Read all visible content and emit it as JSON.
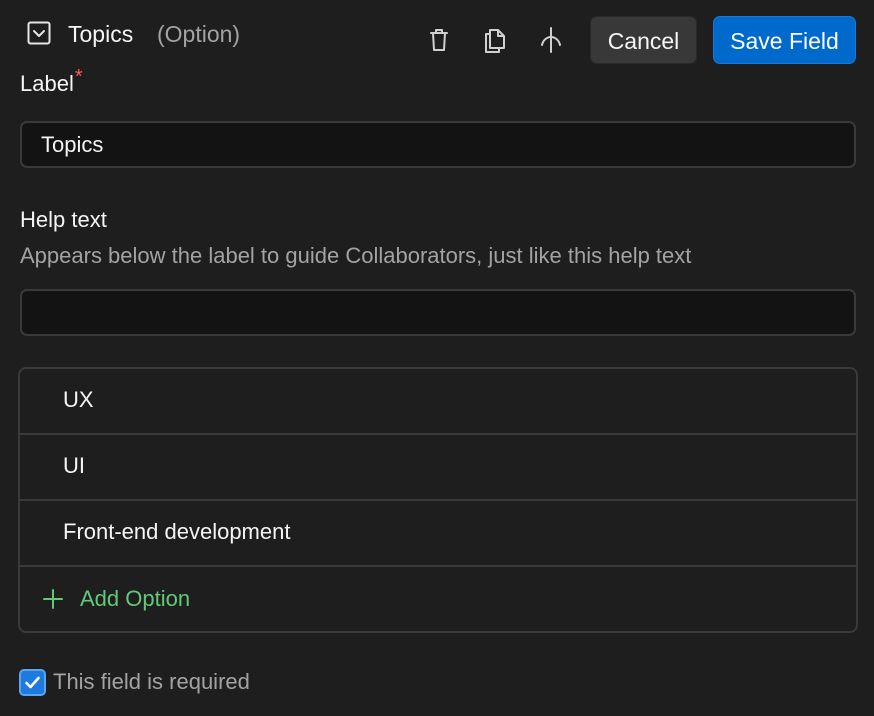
{
  "header": {
    "field_type_icon": "dropdown-square-icon",
    "title": "Topics",
    "field_type": "(Option)",
    "tools": [
      {
        "name": "delete",
        "icon": "trash-icon"
      },
      {
        "name": "duplicate",
        "icon": "copy-icon"
      },
      {
        "name": "branch",
        "icon": "branch-icon"
      }
    ],
    "cancel_label": "Cancel",
    "save_label": "Save Field"
  },
  "label_section": {
    "title": "Label",
    "required_marker": "*",
    "value": "Topics"
  },
  "help_section": {
    "title": "Help text",
    "description": "Appears below the label to guide Collaborators, just like this help text",
    "value": "",
    "placeholder": ""
  },
  "options": {
    "items": [
      {
        "label": "UX"
      },
      {
        "label": "UI"
      },
      {
        "label": "Front-end development"
      }
    ],
    "add_label": "Add Option",
    "add_icon": "plus-icon"
  },
  "required_checkbox": {
    "checked": true,
    "label": "This field is required"
  },
  "colors": {
    "background": "#1e1e1e",
    "primary_button": "#006acc",
    "add_option": "#63c97a",
    "required_star": "#ff5a5a",
    "checkbox": "#1f7ae0"
  }
}
